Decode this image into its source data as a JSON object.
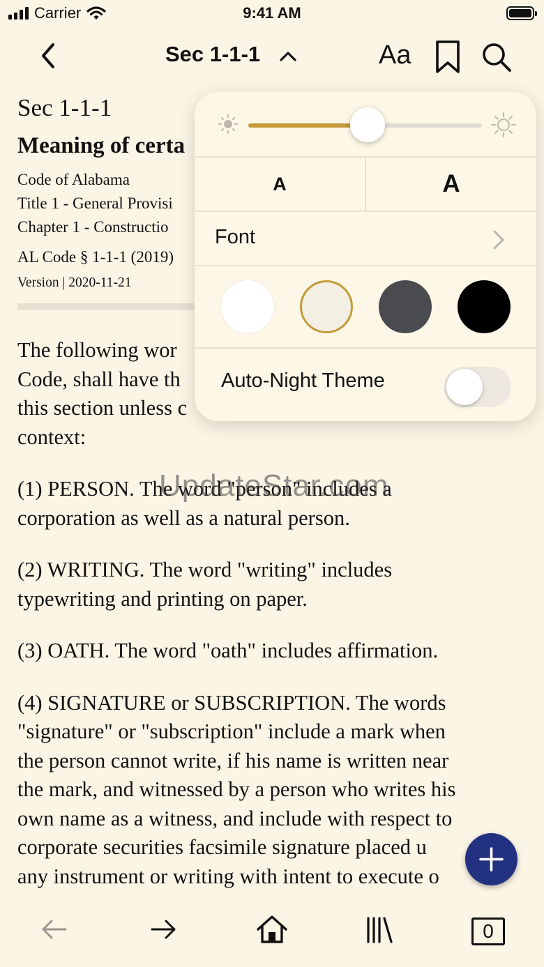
{
  "status_bar": {
    "carrier": "Carrier",
    "time": "9:41 AM"
  },
  "nav": {
    "title": "Sec 1-1-1",
    "font_settings_label": "Aa"
  },
  "document": {
    "section_number": "Sec 1-1-1",
    "section_title": "Meaning of certa",
    "code": "Code of Alabama",
    "title_line": "Title 1 - General Provisi",
    "chapter_line": "Chapter 1 - Constructio",
    "citation": "AL Code § 1-1-1 (2019)",
    "version": "Version | 2020-11-21",
    "paragraphs": [
      "The following wor\nCode, shall have th\nthis section unless c\ncontext:",
      "(1) PERSON. The word \"person\" includes a\ncorporation as well as a natural person.",
      "(2) WRITING. The word \"writing\" includes\ntypewriting and printing on paper.",
      "(3) OATH. The word \"oath\" includes affirmation.",
      "(4) SIGNATURE or SUBSCRIPTION. The words\n\"signature\" or \"subscription\" include a mark when\nthe person cannot write, if his name is written near\nthe mark, and witnessed by a person who writes his\nown name as a witness, and include with respect to\ncorporate securities facsimile signature placed u\nany instrument or writing with intent to execute o"
    ]
  },
  "watermark": "UpdateStar.com",
  "settings": {
    "brightness": 0.51,
    "size_small_label": "A",
    "size_large_label": "A",
    "font_label": "Font",
    "themes": [
      {
        "name": "white",
        "color": "#ffffff",
        "selected": false
      },
      {
        "name": "sepia",
        "color": "#f3efe3",
        "selected": true
      },
      {
        "name": "gray",
        "color": "#4a4b4e",
        "selected": false
      },
      {
        "name": "night",
        "color": "#000000",
        "selected": false
      }
    ],
    "auto_night_label": "Auto-Night Theme",
    "auto_night_enabled": false
  },
  "toolbar": {
    "tab_count": "0"
  },
  "colors": {
    "background": "#fbf5e6",
    "accent": "#c49a3a",
    "fab": "#223281"
  }
}
